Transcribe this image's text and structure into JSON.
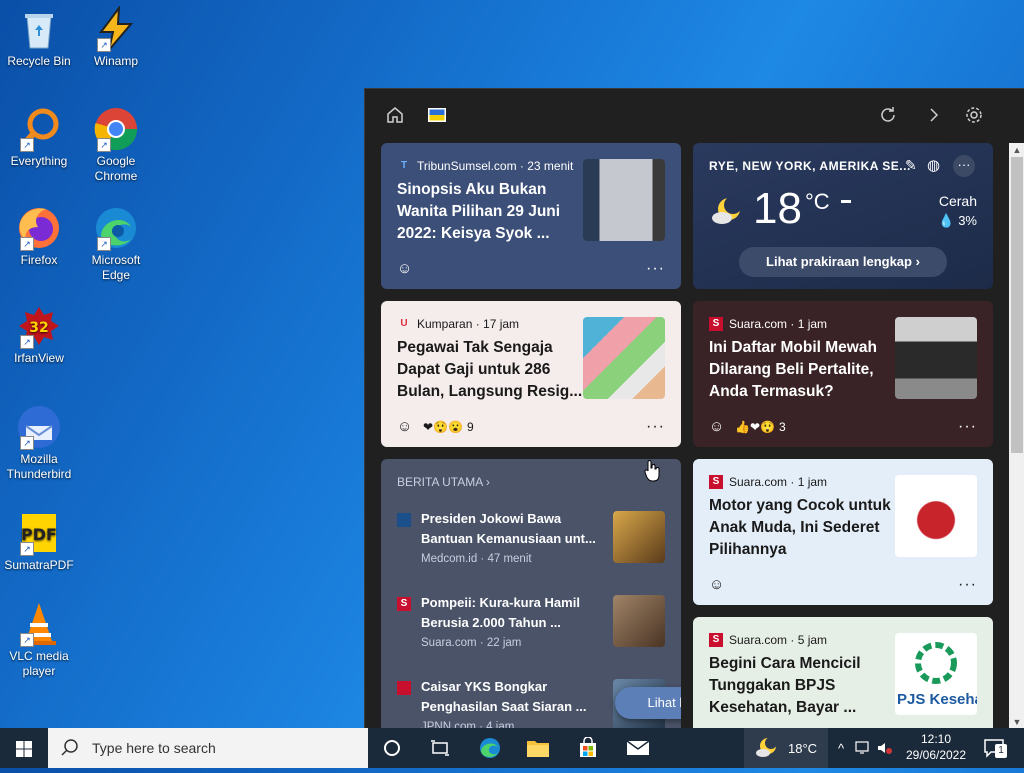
{
  "desktop": {
    "icons": [
      {
        "label": "Recycle Bin"
      },
      {
        "label": "Winamp"
      },
      {
        "label": "Everything"
      },
      {
        "label": "Google Chrome"
      },
      {
        "label": "Firefox"
      },
      {
        "label": "Microsoft Edge"
      },
      {
        "label": "IrfanView"
      },
      {
        "label": "Mozilla Thunderbird"
      },
      {
        "label": "SumatraPDF"
      },
      {
        "label": "VLC media player"
      }
    ]
  },
  "widgets": {
    "cards": {
      "tribun": {
        "source": "TribunSumsel.com · 23 menit",
        "headline": "Sinopsis Aku Bukan Wanita Pilihan 29 Juni 2022: Keisya Syok ...",
        "more": "···"
      },
      "weather": {
        "location": "RYE, NEW YORK, AMERIKA SE...",
        "temp": "18",
        "unit": "°C",
        "condition": "Cerah",
        "precip": "3%",
        "forecast_btn": "Lihat prakiraan lengkap",
        "more": "···"
      },
      "kumparan": {
        "source": "Kumparan · 17 jam",
        "headline": "Pegawai Tak Sengaja Dapat Gaji untuk 286 Bulan, Langsung Resig...",
        "reaction_count": "9",
        "more": "···"
      },
      "suara_mobil": {
        "source": "Suara.com · 1 jam",
        "headline": "Ini Daftar Mobil Mewah Dilarang Beli Pertalite, Anda Termasuk?",
        "reaction_count": "3",
        "more": "···"
      },
      "berita": {
        "title": "BERITA UTAMA",
        "items": [
          {
            "headline": "Presiden Jokowi Bawa Bantuan Kemanusiaan unt...",
            "source": "Medcom.id · 47 menit"
          },
          {
            "headline": "Pompeii: Kura-kura Hamil Berusia 2.000 Tahun ...",
            "source": "Suara.com · 22 jam"
          },
          {
            "headline": "Caisar YKS Bongkar Penghasilan Saat Siaran ...",
            "source": "JPNN.com · 4 jam"
          }
        ],
        "see_more": "Lihat lainnya"
      },
      "suara_motor": {
        "source": "Suara.com · 1 jam",
        "headline": "Motor yang Cocok untuk Anak Muda, Ini Sederet Pilihannya",
        "more": "···"
      },
      "suara_bpjs": {
        "source": "Suara.com · 5 jam",
        "headline": "Begini Cara Mencicil Tunggakan BPJS Kesehatan, Bayar ...",
        "thumb_text": "PJS Keseha"
      }
    }
  },
  "taskbar": {
    "search_placeholder": "Type here to search",
    "weather_temp": "18°C",
    "time": "12:10",
    "date": "29/06/2022",
    "notif_count": "1"
  }
}
